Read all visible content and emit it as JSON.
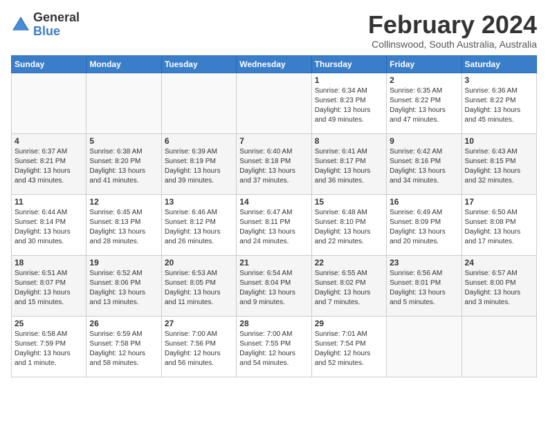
{
  "header": {
    "logo_general": "General",
    "logo_blue": "Blue",
    "month_title": "February 2024",
    "location": "Collinswood, South Australia, Australia"
  },
  "days_of_week": [
    "Sunday",
    "Monday",
    "Tuesday",
    "Wednesday",
    "Thursday",
    "Friday",
    "Saturday"
  ],
  "weeks": [
    [
      {
        "day": "",
        "info": ""
      },
      {
        "day": "",
        "info": ""
      },
      {
        "day": "",
        "info": ""
      },
      {
        "day": "",
        "info": ""
      },
      {
        "day": "1",
        "info": "Sunrise: 6:34 AM\nSunset: 8:23 PM\nDaylight: 13 hours\nand 49 minutes."
      },
      {
        "day": "2",
        "info": "Sunrise: 6:35 AM\nSunset: 8:22 PM\nDaylight: 13 hours\nand 47 minutes."
      },
      {
        "day": "3",
        "info": "Sunrise: 6:36 AM\nSunset: 8:22 PM\nDaylight: 13 hours\nand 45 minutes."
      }
    ],
    [
      {
        "day": "4",
        "info": "Sunrise: 6:37 AM\nSunset: 8:21 PM\nDaylight: 13 hours\nand 43 minutes."
      },
      {
        "day": "5",
        "info": "Sunrise: 6:38 AM\nSunset: 8:20 PM\nDaylight: 13 hours\nand 41 minutes."
      },
      {
        "day": "6",
        "info": "Sunrise: 6:39 AM\nSunset: 8:19 PM\nDaylight: 13 hours\nand 39 minutes."
      },
      {
        "day": "7",
        "info": "Sunrise: 6:40 AM\nSunset: 8:18 PM\nDaylight: 13 hours\nand 37 minutes."
      },
      {
        "day": "8",
        "info": "Sunrise: 6:41 AM\nSunset: 8:17 PM\nDaylight: 13 hours\nand 36 minutes."
      },
      {
        "day": "9",
        "info": "Sunrise: 6:42 AM\nSunset: 8:16 PM\nDaylight: 13 hours\nand 34 minutes."
      },
      {
        "day": "10",
        "info": "Sunrise: 6:43 AM\nSunset: 8:15 PM\nDaylight: 13 hours\nand 32 minutes."
      }
    ],
    [
      {
        "day": "11",
        "info": "Sunrise: 6:44 AM\nSunset: 8:14 PM\nDaylight: 13 hours\nand 30 minutes."
      },
      {
        "day": "12",
        "info": "Sunrise: 6:45 AM\nSunset: 8:13 PM\nDaylight: 13 hours\nand 28 minutes."
      },
      {
        "day": "13",
        "info": "Sunrise: 6:46 AM\nSunset: 8:12 PM\nDaylight: 13 hours\nand 26 minutes."
      },
      {
        "day": "14",
        "info": "Sunrise: 6:47 AM\nSunset: 8:11 PM\nDaylight: 13 hours\nand 24 minutes."
      },
      {
        "day": "15",
        "info": "Sunrise: 6:48 AM\nSunset: 8:10 PM\nDaylight: 13 hours\nand 22 minutes."
      },
      {
        "day": "16",
        "info": "Sunrise: 6:49 AM\nSunset: 8:09 PM\nDaylight: 13 hours\nand 20 minutes."
      },
      {
        "day": "17",
        "info": "Sunrise: 6:50 AM\nSunset: 8:08 PM\nDaylight: 13 hours\nand 17 minutes."
      }
    ],
    [
      {
        "day": "18",
        "info": "Sunrise: 6:51 AM\nSunset: 8:07 PM\nDaylight: 13 hours\nand 15 minutes."
      },
      {
        "day": "19",
        "info": "Sunrise: 6:52 AM\nSunset: 8:06 PM\nDaylight: 13 hours\nand 13 minutes."
      },
      {
        "day": "20",
        "info": "Sunrise: 6:53 AM\nSunset: 8:05 PM\nDaylight: 13 hours\nand 11 minutes."
      },
      {
        "day": "21",
        "info": "Sunrise: 6:54 AM\nSunset: 8:04 PM\nDaylight: 13 hours\nand 9 minutes."
      },
      {
        "day": "22",
        "info": "Sunrise: 6:55 AM\nSunset: 8:02 PM\nDaylight: 13 hours\nand 7 minutes."
      },
      {
        "day": "23",
        "info": "Sunrise: 6:56 AM\nSunset: 8:01 PM\nDaylight: 13 hours\nand 5 minutes."
      },
      {
        "day": "24",
        "info": "Sunrise: 6:57 AM\nSunset: 8:00 PM\nDaylight: 13 hours\nand 3 minutes."
      }
    ],
    [
      {
        "day": "25",
        "info": "Sunrise: 6:58 AM\nSunset: 7:59 PM\nDaylight: 13 hours\nand 1 minute."
      },
      {
        "day": "26",
        "info": "Sunrise: 6:59 AM\nSunset: 7:58 PM\nDaylight: 12 hours\nand 58 minutes."
      },
      {
        "day": "27",
        "info": "Sunrise: 7:00 AM\nSunset: 7:56 PM\nDaylight: 12 hours\nand 56 minutes."
      },
      {
        "day": "28",
        "info": "Sunrise: 7:00 AM\nSunset: 7:55 PM\nDaylight: 12 hours\nand 54 minutes."
      },
      {
        "day": "29",
        "info": "Sunrise: 7:01 AM\nSunset: 7:54 PM\nDaylight: 12 hours\nand 52 minutes."
      },
      {
        "day": "",
        "info": ""
      },
      {
        "day": "",
        "info": ""
      }
    ]
  ]
}
